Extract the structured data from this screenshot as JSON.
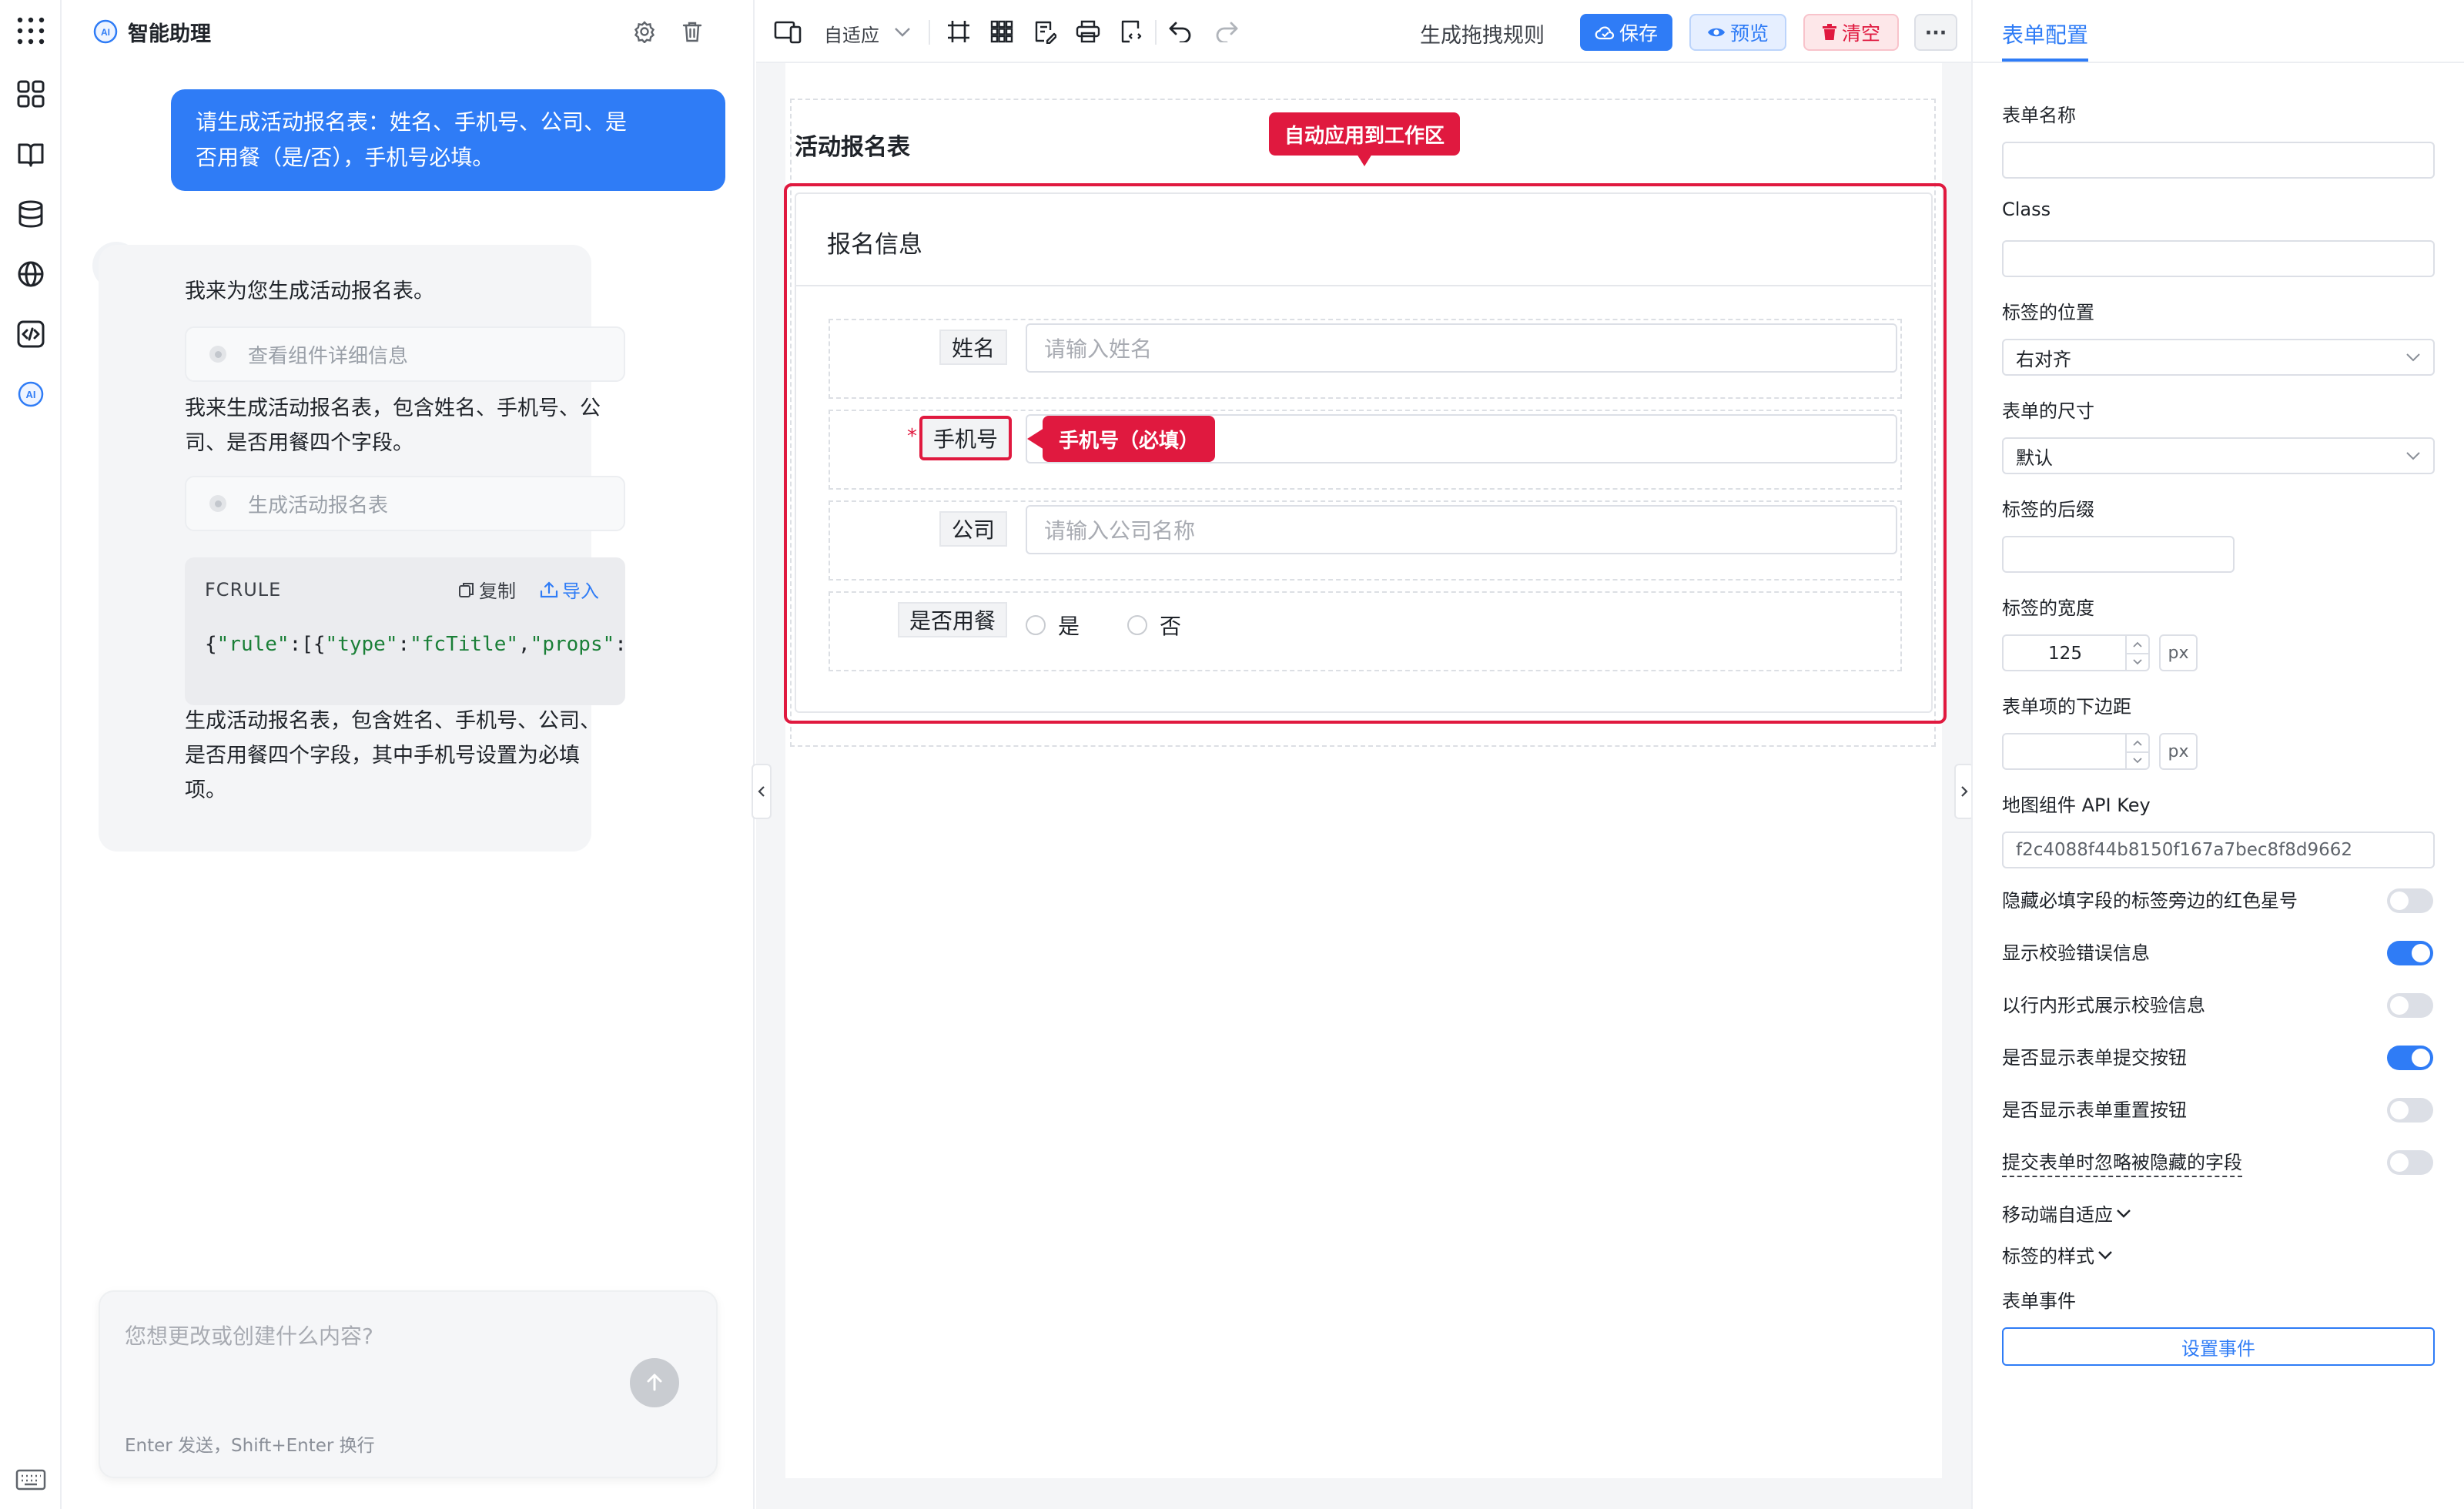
{
  "rail": {
    "icons": [
      "apps-grid-icon",
      "components-icon",
      "book-icon",
      "database-icon",
      "globe-icon",
      "code-icon",
      "ai-icon",
      "keyboard-icon"
    ]
  },
  "ai_panel": {
    "badge": "AI",
    "title": "智能助理",
    "user_message_line1": "请生成活动报名表：姓名、手机号、公司、是",
    "user_message_line2": "否用餐（是/否），手机号必填。",
    "reply_intro": "我来为您生成活动报名表。",
    "tool_call_1": "查看组件详细信息",
    "reply_mid_line1": "我来生成活动报名表，包含姓名、手机号、公",
    "reply_mid_line2": "司、是否用餐四个字段。",
    "tool_call_2": "生成活动报名表",
    "code_title": "FCRULE",
    "copy_label": "复制",
    "import_label": "导入",
    "code_open": "{",
    "code_k1": "\"rule\"",
    "code_p1": ":[{",
    "code_k2": "\"type\"",
    "code_p2": ":",
    "code_v2": "\"fcTitle\"",
    "code_p3": ",",
    "code_k3": "\"props\"",
    "code_p4": ":",
    "reply_end_line1": "生成活动报名表，包含姓名、手机号、公司、",
    "reply_end_line2": "是否用餐四个字段，其中手机号设置为必填",
    "reply_end_line3": "项。",
    "input_placeholder": "您想更改或创建什么内容?",
    "input_hint": "Enter 发送，Shift+Enter 换行"
  },
  "toolbar": {
    "device_label": "自适应",
    "generate_rule": "生成拖拽规则",
    "save": "保存",
    "preview": "预览",
    "clear": "清空",
    "more": "···"
  },
  "canvas": {
    "form_title": "活动报名表",
    "callout_workspace": "自动应用到工作区",
    "section_title": "报名信息",
    "callout_phone": "手机号（必填）",
    "fields": {
      "name_label": "姓名",
      "name_placeholder": "请输入姓名",
      "phone_label": "手机号",
      "phone_required_mark": "*",
      "company_label": "公司",
      "company_placeholder": "请输入公司名称",
      "meal_label": "是否用餐",
      "meal_yes": "是",
      "meal_no": "否"
    }
  },
  "config": {
    "tab_label": "表单配置",
    "form_name_label": "表单名称",
    "form_name_value": "",
    "class_label": "Class",
    "class_value": "",
    "label_position_label": "标签的位置",
    "label_position_value": "右对齐",
    "form_size_label": "表单的尺寸",
    "form_size_value": "默认",
    "label_suffix_label": "标签的后缀",
    "label_width_label": "标签的宽度",
    "label_width_value": "125",
    "unit_px": "px",
    "item_margin_label": "表单项的下边距",
    "item_margin_value": "",
    "api_key_label": "地图组件 API Key",
    "api_key_value": "f2c4088f44b8150f167a7bec8f8d9662",
    "toggles": [
      {
        "label": "隐藏必填字段的标签旁边的红色星号",
        "on": false
      },
      {
        "label": "显示校验错误信息",
        "on": true
      },
      {
        "label": "以行内形式展示校验信息",
        "on": false
      },
      {
        "label": "是否显示表单提交按钮",
        "on": true
      },
      {
        "label": "是否显示表单重置按钮",
        "on": false
      },
      {
        "label": "提交表单时忽略被隐藏的字段",
        "on": false
      }
    ],
    "mobile_label": "移动端自适应",
    "label_style_label": "标签的样式",
    "form_events_label": "表单事件",
    "set_events_button": "设置事件"
  },
  "colors": {
    "accent": "#2f7cf6",
    "danger": "#e0193f",
    "preview_bg": "#e6efff",
    "clear_bg": "#fde7e9"
  }
}
